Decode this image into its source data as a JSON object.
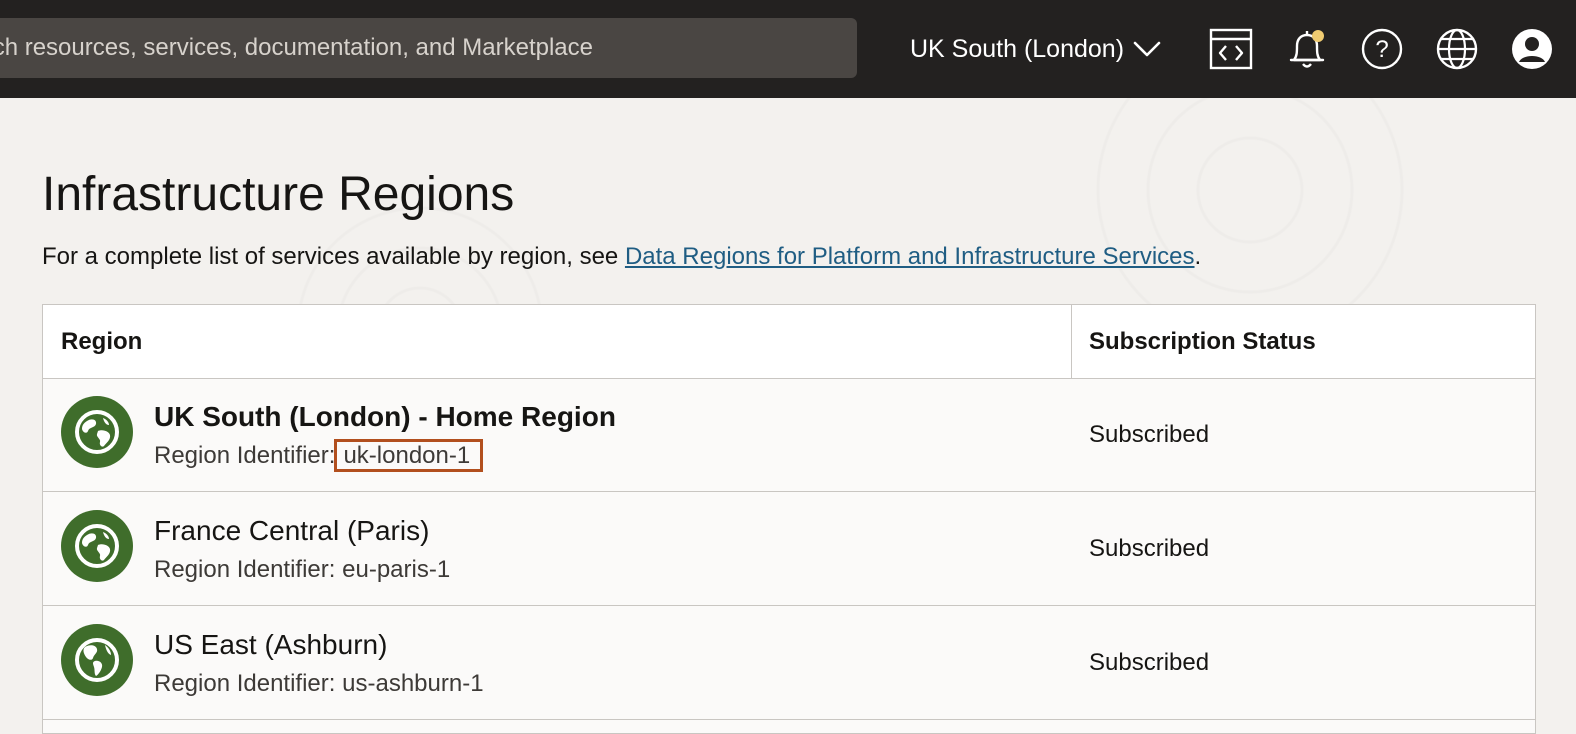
{
  "topbar": {
    "search_placeholder": "Search resources, services, documentation, and Marketplace",
    "region_label": "UK South (London)",
    "icons": [
      "code-editor-icon",
      "bell-icon",
      "help-icon",
      "globe-language-icon",
      "user-avatar-icon"
    ],
    "notification_dot_color": "#f0cc71"
  },
  "page": {
    "title": "Infrastructure Regions",
    "subtitle_prefix": "For a complete list of services available by region, see ",
    "subtitle_link": "Data Regions for Platform and Infrastructure Services",
    "subtitle_suffix": "."
  },
  "table": {
    "headers": {
      "region": "Region",
      "status": "Subscription Status"
    },
    "id_label": "Region Identifier:",
    "rows": [
      {
        "name": "UK South (London) - Home Region",
        "identifier": "uk-london-1",
        "status": "Subscribed",
        "home": true,
        "highlighted": true,
        "icon": "globe-europe-icon"
      },
      {
        "name": "France Central (Paris)",
        "identifier": "eu-paris-1",
        "status": "Subscribed",
        "home": false,
        "highlighted": false,
        "icon": "globe-europe-icon"
      },
      {
        "name": "US East (Ashburn)",
        "identifier": "us-ashburn-1",
        "status": "Subscribed",
        "home": false,
        "highlighted": false,
        "icon": "globe-americas-icon"
      }
    ]
  },
  "colors": {
    "topbar_bg": "#232120",
    "globe_green": "#3f6d2b",
    "link_blue": "#1f5d83",
    "highlight_outline": "#b24f1e"
  }
}
